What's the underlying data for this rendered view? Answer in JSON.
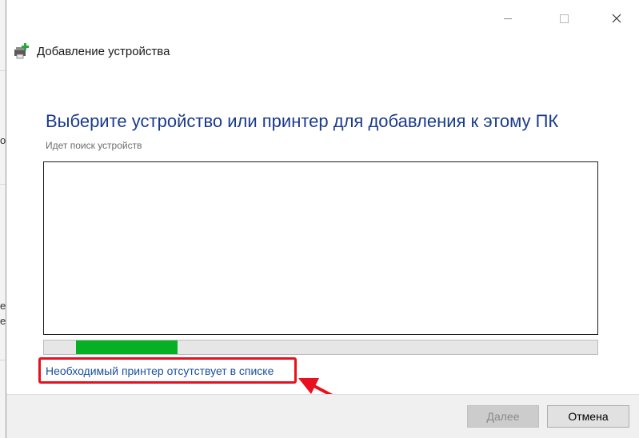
{
  "window": {
    "title": "Добавление устройства",
    "icon": "printer-add-icon"
  },
  "caption_buttons": {
    "minimize_icon": "minimize-icon",
    "maximize_icon": "maximize-icon",
    "close_glyph": "✕"
  },
  "background_window": {
    "glyphs": [
      "о",
      "е",
      "е"
    ]
  },
  "main": {
    "heading": "Выберите устройство или принтер для добавления к этому ПК",
    "status_text": "Идет поиск устройств",
    "device_list": [],
    "progress": {
      "indeterminate": true,
      "fill_color": "#06b025"
    },
    "missing_printer_link": "Необходимый принтер отсутствует в списке"
  },
  "annotations": {
    "highlight_color": "#e8101e"
  },
  "footer": {
    "next_label": "Далее",
    "next_enabled": false,
    "cancel_label": "Отмена"
  }
}
